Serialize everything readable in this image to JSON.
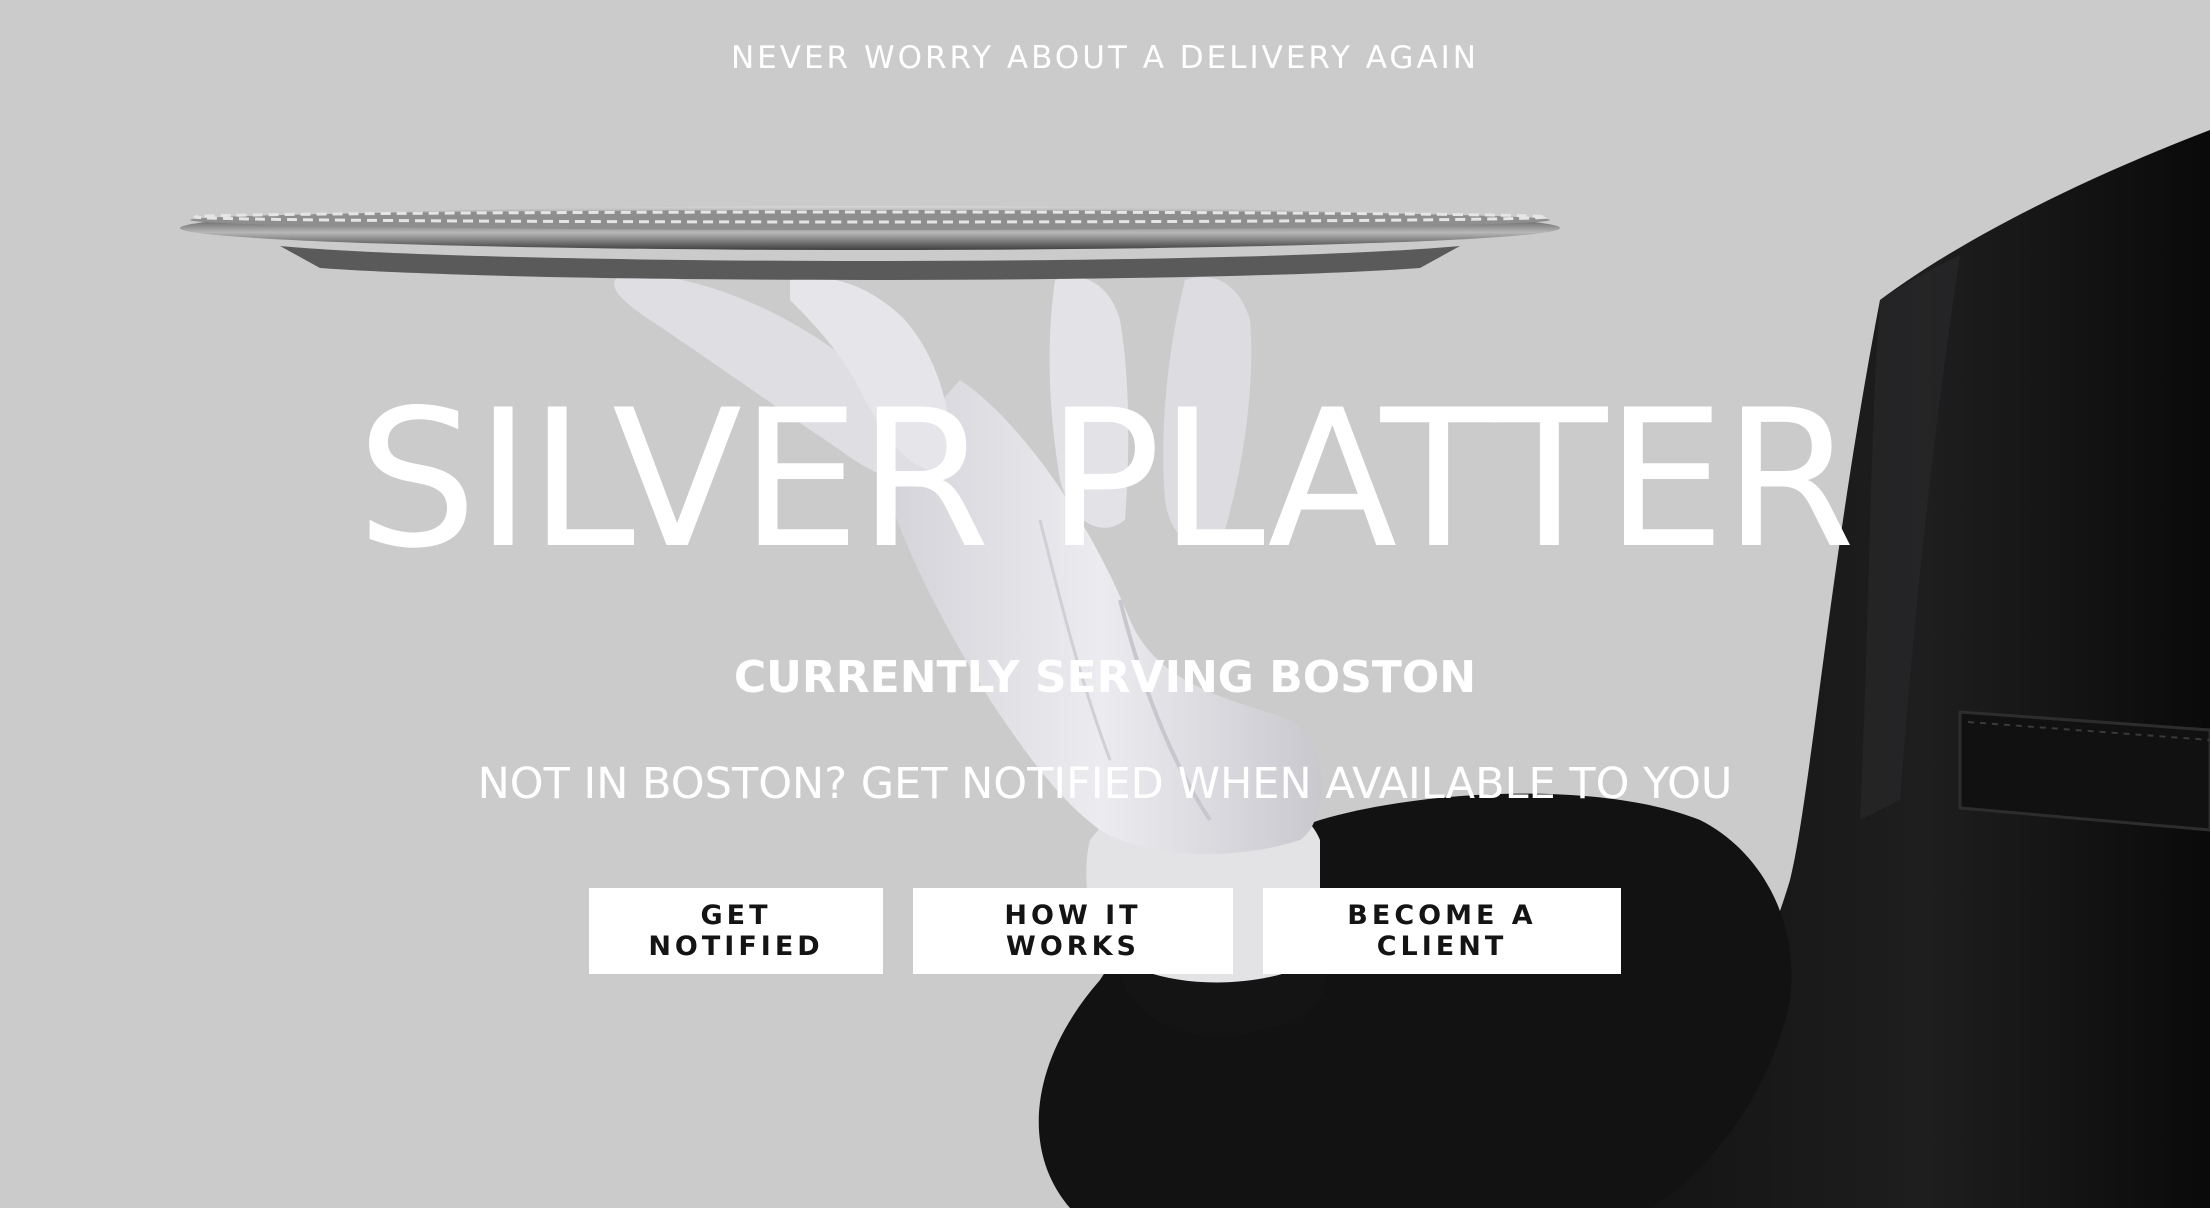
{
  "hero": {
    "tagline": "NEVER WORRY ABOUT A DELIVERY AGAIN",
    "title": "SILVER PLATTER",
    "serving": "CURRENTLY SERVING BOSTON",
    "notify_text": "NOT IN BOSTON? GET NOTIFIED WHEN AVAILABLE TO YOU",
    "image": {
      "subject": "butler-gloved-hand-holding-silver-tray",
      "background_color": "#cbcbcb",
      "glove_color": "#e6e6e9",
      "suit_color": "#0f0f10",
      "tray_color": "#8a8a8a"
    }
  },
  "buttons": {
    "get_notified": "GET NOTIFIED",
    "how_it_works": "HOW IT WORKS",
    "become_client": "BECOME A CLIENT"
  },
  "colors": {
    "text": "#ffffff",
    "button_bg": "#ffffff",
    "button_text": "#141414"
  }
}
